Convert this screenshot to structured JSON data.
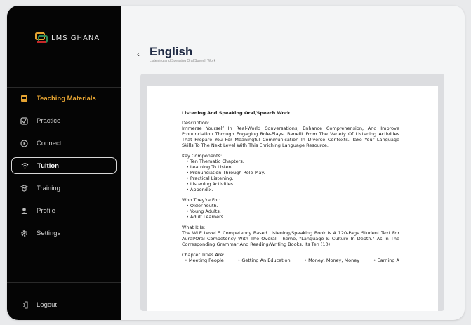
{
  "app": {
    "logo_text": "LMS GHANA"
  },
  "sidebar": {
    "items": [
      {
        "label": "Teaching Materials",
        "icon": "book-icon"
      },
      {
        "label": "Practice",
        "icon": "practice-icon"
      },
      {
        "label": "Connect",
        "icon": "play-circle-icon"
      },
      {
        "label": "Tuition",
        "icon": "wifi-icon"
      },
      {
        "label": "Training",
        "icon": "training-icon"
      },
      {
        "label": "Profile",
        "icon": "user-icon"
      },
      {
        "label": "Settings",
        "icon": "gear-icon"
      }
    ],
    "logout_label": "Logout"
  },
  "header": {
    "back_glyph": "‹",
    "title": "English",
    "subtitle": "Listening and Speaking Oral/Speech Work"
  },
  "document": {
    "heading": "Listening And Speaking Oral/Speech Work",
    "description_label": "Description:",
    "description": "Immerse Yourself In Real-World Conversations, Enhance Comprehension, And Improve Pronunciation Through Engaging Role-Plays. Benefit From The Variety Of Listening Activities That Prepare You For Meaningful Communication In Diverse Contexts. Take Your Language Skills To The Next Level With This Enriching Language Resource.",
    "components_label": "Key Components:",
    "components": [
      "Ten Thematic Chapters.",
      "Learning To Listen.",
      "Pronunciation Through Role-Play.",
      "Practical Listening.",
      "Listening Activities.",
      "Appendix."
    ],
    "audience_label": "Who They're For:",
    "audience": [
      "Older Youth.",
      "Young Adults.",
      "Adult Learners"
    ],
    "what_label": "What It Is:",
    "what": "The WLE Level 5 Competency Based Listening/Speaking Book Is A 120-Page Student Text For Aural/Oral Competency With The Overall Theme, \"Language & Culture In Depth.\" As In The Corresponding Grammar And Reading/Writing Books, Its Ten (10)",
    "chapters_label": "Chapter Titles Are:",
    "chapters": [
      "Meeting People",
      "Getting An Education",
      "Money, Money, Money",
      "Earning A"
    ]
  },
  "colors": {
    "accent": "#e6a432",
    "sidebar_bg": "#050505",
    "title": "#1f2a44"
  }
}
